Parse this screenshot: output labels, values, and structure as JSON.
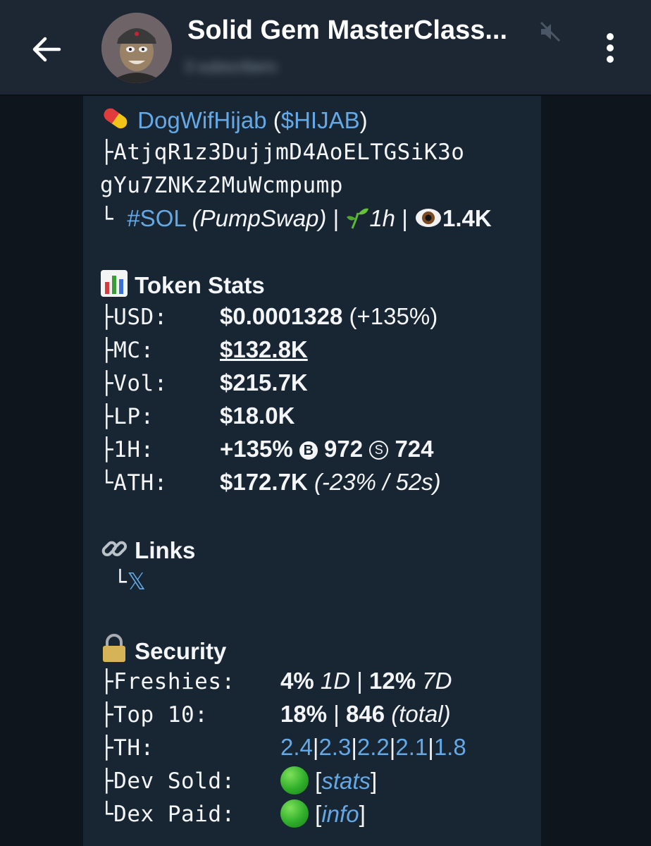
{
  "header": {
    "title": "Solid Gem MasterClass...",
    "subtitle": "3 subscribers"
  },
  "token": {
    "name": "DogWifHijab",
    "ticker": "$HIJAB",
    "address_line1": "AtjqR1z3DujjmD4AoELTGSiK3o",
    "address_line2": "gYu7ZNKz2MuWcmpump",
    "chain": "#SOL",
    "dex": "(PumpSwap)",
    "age": "1h",
    "views": "1.4K"
  },
  "stats": {
    "heading": "Token Stats",
    "rows": [
      {
        "label": "USD:",
        "value": "$0.0001328",
        "extra": "(+135%)"
      },
      {
        "label": "MC:",
        "value": "$132.8K"
      },
      {
        "label": "Vol:",
        "value": "$215.7K"
      },
      {
        "label": "LP:",
        "value": "$18.0K"
      },
      {
        "label": "1H:",
        "value": "+135%",
        "buy_icon": "B",
        "buys": "972",
        "sell_icon": "S",
        "sells": "724"
      },
      {
        "label": "ATH:",
        "value": "$172.7K",
        "extra": "(-23% / 52s)"
      }
    ]
  },
  "links": {
    "heading": "Links",
    "x_label": "𝕏"
  },
  "security": {
    "heading": "Security",
    "freshies": {
      "label": "Freshies:",
      "v1": "4%",
      "p1": "1D",
      "v2": "12%",
      "p2": "7D"
    },
    "top10": {
      "label": "Top 10:",
      "pct": "18%",
      "count": "846",
      "note": "(total)"
    },
    "th": {
      "label": "TH:",
      "values": [
        "2.4",
        "2.3",
        "2.2",
        "2.1",
        "1.8"
      ]
    },
    "dev_sold": {
      "label": "Dev Sold:",
      "link": "stats"
    },
    "dex_paid": {
      "label": "Dex Paid:",
      "link": "info"
    }
  },
  "colors": {
    "link": "#64a9e6",
    "bubble": "#182533",
    "header": "#1d2733"
  }
}
